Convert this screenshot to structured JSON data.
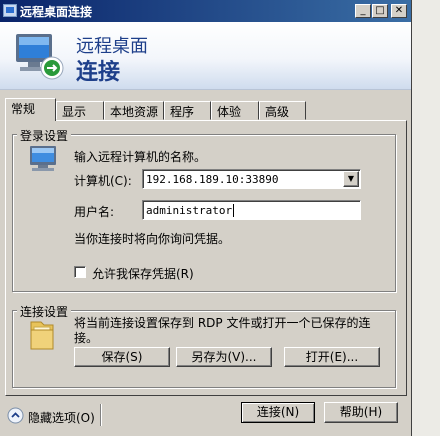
{
  "window": {
    "title": "远程桌面连接"
  },
  "header": {
    "subtitle": "远程桌面",
    "title": "连接"
  },
  "tabs": [
    {
      "label": "常规",
      "active": true
    },
    {
      "label": "显示"
    },
    {
      "label": "本地资源"
    },
    {
      "label": "程序"
    },
    {
      "label": "体验"
    },
    {
      "label": "高级"
    }
  ],
  "login_settings": {
    "legend": "登录设置",
    "prompt": "输入远程计算机的名称。",
    "computer_label": "计算机(C):",
    "computer_value": "192.168.189.10:33890",
    "username_label": "用户名:",
    "username_value": "administrator",
    "credential_note": "当你连接时将向你询问凭据。",
    "save_credentials_label": "允许我保存凭据(R)",
    "save_credentials_checked": false
  },
  "connection_settings": {
    "legend": "连接设置",
    "description": "将当前连接设置保存到 RDP 文件或打开一个已保存的连接。",
    "save_button": "保存(S)",
    "save_as_button": "另存为(V)...",
    "open_button": "打开(E)..."
  },
  "footer": {
    "hide_options": "隐藏选项(O)",
    "connect_button": "连接(N)",
    "help_button": "帮助(H)"
  },
  "colors": {
    "title_bar": "#0a246a",
    "header_text": "#1e3f8a",
    "face": "#d4d0c8"
  }
}
